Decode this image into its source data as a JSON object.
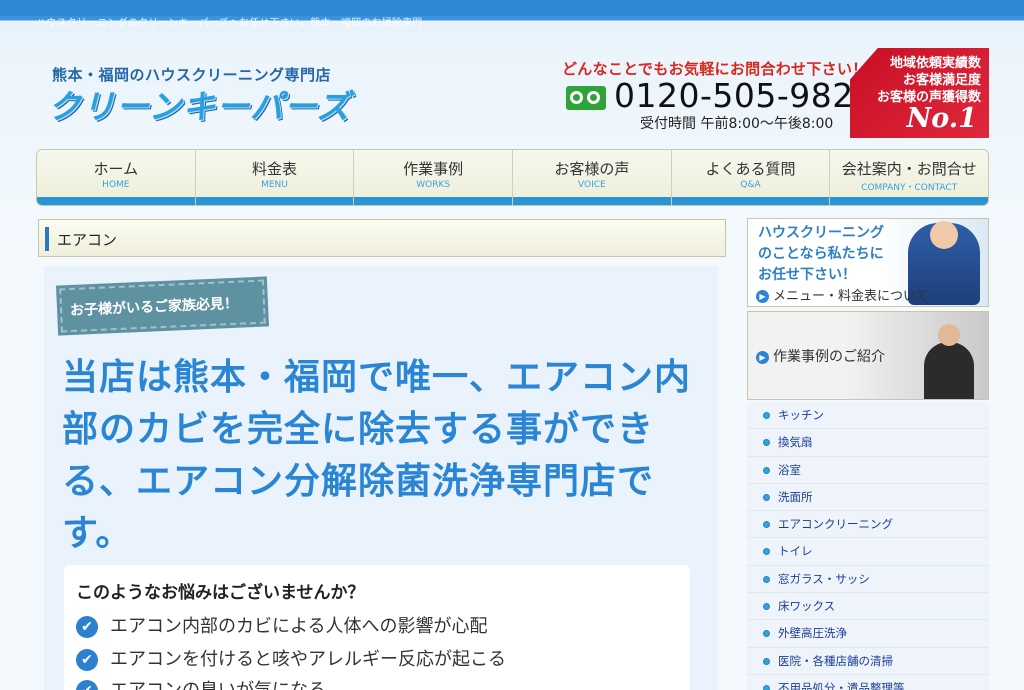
{
  "header": {
    "tagline": "ハウスクリーニングのクリーンキーパーズへお任せ下さい。熊本・福岡のお掃除専門",
    "logo_sub": "熊本・福岡のハウスクリーニング専門店",
    "logo_main": "クリーンキーパーズ",
    "contact_lead": "どんなことでもお気軽にお問合わせ下さい！",
    "phone": "0120-505-982",
    "hours": "受付時間 午前8:00～午後8:00",
    "award_lines": [
      "地域依頼実績数",
      "お客様満足度",
      "お客様の声獲得数"
    ],
    "award_rank": "No.1"
  },
  "nav": [
    {
      "jp": "ホーム",
      "en": "HOME"
    },
    {
      "jp": "料金表",
      "en": "MENU"
    },
    {
      "jp": "作業事例",
      "en": "WORKS"
    },
    {
      "jp": "お客様の声",
      "en": "VOICE"
    },
    {
      "jp": "よくある質問",
      "en": "Q&A"
    },
    {
      "jp": "会社案内・お問合せ",
      "en": "COMPANY・CONTACT"
    }
  ],
  "main": {
    "section_title": "エアコン",
    "ribbon": "お子様がいるご家族必見！",
    "headline": "当店は熊本・福岡で唯一、エアコン内部のカビを完全に除去する事ができる、エアコン分解除菌洗浄専門店です。",
    "worry_title": "このようなお悩みはございませんか？",
    "worries": [
      "エアコン内部のカビによる人体への影響が心配",
      "エアコンを付けると咳やアレルギー反応が起こる",
      "エアコンの臭いが気になる"
    ]
  },
  "sidebar": {
    "banner1_text": [
      "ハウスクリーニング",
      "のことなら私たちに",
      "お任せ下さい！"
    ],
    "banner1_link": "メニュー・料金表について",
    "banner2_link": "作業事例のご紹介",
    "menu": [
      "キッチン",
      "換気扇",
      "浴室",
      "洗面所",
      "エアコンクリーニング",
      "トイレ",
      "窓ガラス・サッシ",
      "床ワックス",
      "外壁高圧洗浄",
      "医院・各種店舗の清掃",
      "不用品処分・遺品整理等"
    ]
  },
  "colors": {
    "accent": "#2a86d4",
    "nav_bar": "#2a93d8",
    "award": "#c80f25",
    "contact_red": "#d8281e",
    "freedial_green": "#2fa338"
  }
}
